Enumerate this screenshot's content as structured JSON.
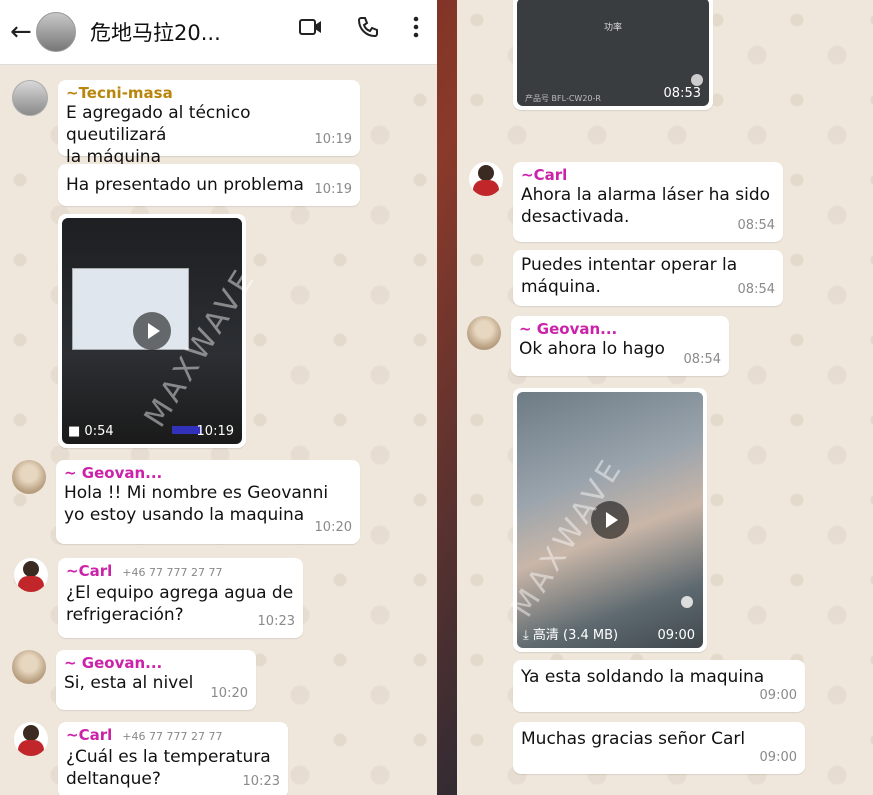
{
  "header": {
    "back_icon": "arrow-left-icon",
    "title": "危地马拉20...",
    "video_icon": "video-call-icon",
    "call_icon": "phone-icon",
    "menu_icon": "more-vertical-icon"
  },
  "left": {
    "m1": {
      "sender": "~Tecni-masa",
      "text": "E agregado al técnico queutilizará\nla máquina",
      "time": "10:19"
    },
    "m2": {
      "text": "Ha presentado un problema",
      "time": "10:19"
    },
    "video1": {
      "duration": "0:54",
      "time": "10:19"
    },
    "m3": {
      "sender": "~ Geovan...",
      "text": "Hola !! Mi nombre es Geovanni\nyo estoy usando la maquina",
      "time": "10:20"
    },
    "m4": {
      "sender": "~Carl",
      "phone": "+46 77 777 27 77",
      "text": "¿El equipo agrega agua de\nrefrigeración?",
      "time": "10:23"
    },
    "m5": {
      "sender": "~ Geovan...",
      "text": "Si, esta al nivel",
      "time": "10:20"
    },
    "m6": {
      "sender": "~Carl",
      "phone": "+46 77 777 27 77",
      "text": "¿Cuál es la temperatura\ndeltanque?",
      "time": "10:23"
    }
  },
  "right": {
    "top_media": {
      "caption": "功率",
      "footer": "产品号  BFL-CW20-R",
      "time": "08:53"
    },
    "m1": {
      "sender": "~Carl",
      "text": "Ahora la alarma láser ha sido\ndesactivada.",
      "time": "08:54"
    },
    "m2": {
      "text": "Puedes intentar operar la\nmáquina.",
      "time": "08:54"
    },
    "m3": {
      "sender": "~ Geovan...",
      "text": "Ok ahora lo hago",
      "time": "08:54"
    },
    "video2": {
      "meta": "高清 (3.4 MB)",
      "time": "09:00"
    },
    "m4": {
      "text": "Ya esta soldando la maquina",
      "time": "09:00"
    },
    "m5": {
      "text": "Muchas gracias señor Carl",
      "time": "09:00"
    }
  },
  "watermark": "MAXWAVE"
}
